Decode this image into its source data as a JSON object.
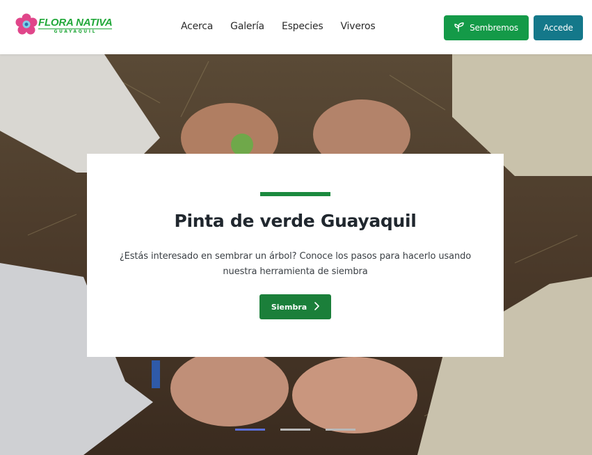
{
  "brand": {
    "title": "FLORA NATIVA",
    "subtitle": "GUAYAQUIL",
    "accent": "#22a83a",
    "logo_icon": "flower-icon"
  },
  "nav": {
    "links": [
      "Acerca",
      "Galería",
      "Especies",
      "Viveros"
    ]
  },
  "actions": {
    "sembremos_label": "Sembremos",
    "sembremos_icon": "sprout-icon",
    "sembremos_color": "#149a48",
    "accede_label": "Accede",
    "accede_color": "#14788a"
  },
  "hero": {
    "title": "Pinta de verde Guayaquil",
    "text": "¿Estás interesado en sembrar un árbol? Conoce los pasos para hacerlo usando nuestra herramienta de siembra",
    "button_label": "Siembra",
    "button_icon": "chevron-right-icon",
    "button_color": "#1b7f3a",
    "slides": 3,
    "active_slide": 1
  }
}
